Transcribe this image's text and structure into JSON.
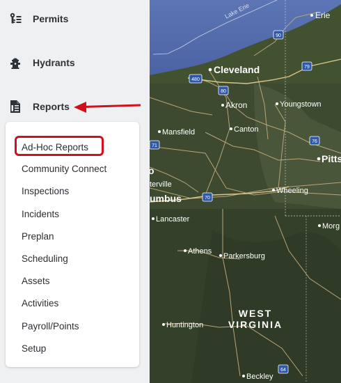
{
  "sidebar": {
    "items": [
      {
        "label": "Permits",
        "icon": "permits-icon"
      },
      {
        "label": "Hydrants",
        "icon": "hydrant-icon"
      },
      {
        "label": "Reports",
        "icon": "document-icon"
      }
    ]
  },
  "reports_menu": {
    "items": [
      "Ad-Hoc Reports",
      "Community Connect",
      "Inspections",
      "Incidents",
      "Preplan",
      "Scheduling",
      "Assets",
      "Activities",
      "Payroll/Points",
      "Setup"
    ],
    "highlighted": "Ad-Hoc Reports"
  },
  "annotation": {
    "arrow_color": "#d0101b",
    "highlight_color": "#d0101b"
  },
  "map": {
    "lake_label": "Lake Erie",
    "cities": [
      "Erie",
      "Cleveland",
      "Akron",
      "Youngstown",
      "Mansfield",
      "Canton",
      "Pitts",
      "terville",
      "umbus",
      "Wheeling",
      "Lancaster",
      "Morg",
      "Athens",
      "Parkersburg",
      "Huntington",
      "Beckley"
    ],
    "state_label_1": "WEST",
    "state_label_2": "VIRGINIA",
    "o_fragment": "o",
    "shields": [
      "90",
      "480",
      "80",
      "79",
      "71",
      "76",
      "70",
      "64"
    ]
  }
}
